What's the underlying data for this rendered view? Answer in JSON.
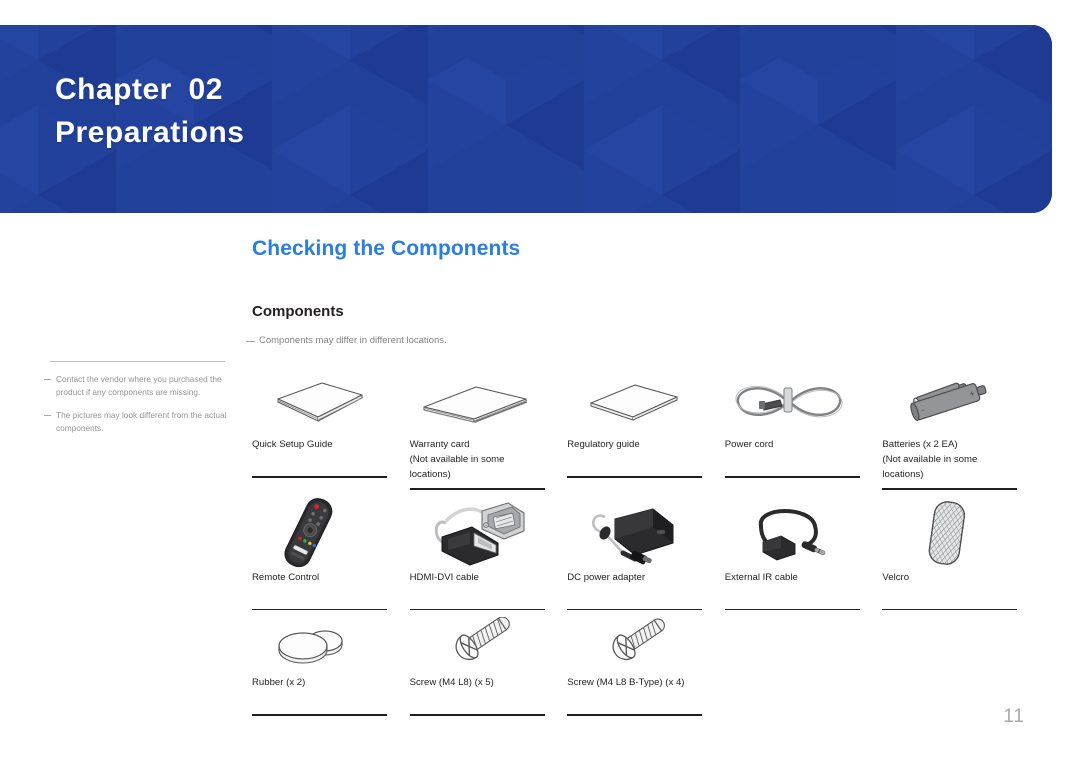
{
  "chapter": {
    "label": "Chapter",
    "number": "02",
    "name": "Preparations",
    "banner_color": "#21409a"
  },
  "section": {
    "title": "Checking the Components",
    "title_color": "#2a7de1",
    "subtitle": "Components",
    "note": "Components may differ in different locations."
  },
  "sidebar": {
    "notes": [
      "Contact the vendor where you purchased the product if any components are missing.",
      "The pictures may look different from the actual components."
    ]
  },
  "components": {
    "rows": [
      [
        {
          "icon": "quick-setup-guide-icon",
          "label": "Quick Setup Guide",
          "sub": ""
        },
        {
          "icon": "warranty-card-icon",
          "label": "Warranty card",
          "sub": "(Not available in some locations)"
        },
        {
          "icon": "regulatory-guide-icon",
          "label": "Regulatory guide",
          "sub": ""
        },
        {
          "icon": "power-cord-icon",
          "label": "Power cord",
          "sub": ""
        },
        {
          "icon": "batteries-icon",
          "label": "Batteries (x 2 EA)",
          "sub": "(Not available in some locations)"
        }
      ],
      [
        {
          "icon": "remote-control-icon",
          "label": "Remote Control",
          "sub": ""
        },
        {
          "icon": "hdmi-dvi-cable-icon",
          "label": "HDMI-DVI cable",
          "sub": ""
        },
        {
          "icon": "dc-power-adapter-icon",
          "label": "DC power adapter",
          "sub": ""
        },
        {
          "icon": "external-ir-cable-icon",
          "label": "External IR cable",
          "sub": ""
        },
        {
          "icon": "velcro-icon",
          "label": "Velcro",
          "sub": ""
        }
      ],
      [
        {
          "icon": "rubber-icon",
          "label": "Rubber (x 2)",
          "sub": ""
        },
        {
          "icon": "screw-m4l8-icon",
          "label": "Screw (M4 L8) (x 5)",
          "sub": ""
        },
        {
          "icon": "screw-m4l8-btype-icon",
          "label": "Screw (M4 L8 B-Type) (x 4)",
          "sub": ""
        }
      ]
    ]
  },
  "footer": {
    "page_number": "11"
  }
}
